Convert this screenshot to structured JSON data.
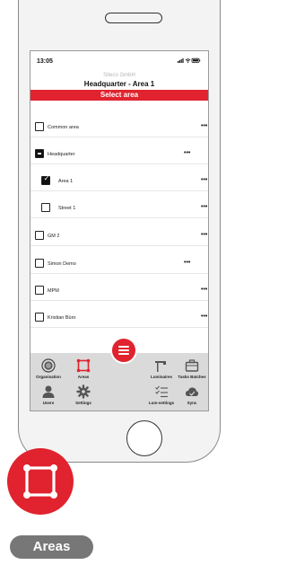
{
  "status_bar": {
    "time": "13:05",
    "icons": "signal-icon wifi-icon battery-icon"
  },
  "header": {
    "company": "Siteco GmbH",
    "area_title": "Headquarter - Area 1",
    "select_area": "Select area"
  },
  "rows": [
    {
      "label": "Common area",
      "checked": false,
      "indent": false,
      "dots": "•••",
      "chevron": ""
    },
    {
      "label": "Headquarter",
      "checked": "partial",
      "indent": false,
      "dots": "•••",
      "chevron": "˄"
    },
    {
      "label": "Area 1",
      "checked": true,
      "indent": true,
      "dots": "•••",
      "chevron": ""
    },
    {
      "label": "Street 1",
      "checked": false,
      "indent": true,
      "dots": "•••",
      "chevron": ""
    },
    {
      "label": "GM 2",
      "checked": false,
      "indent": false,
      "dots": "•••",
      "chevron": ""
    },
    {
      "label": "Simon Demo",
      "checked": false,
      "indent": false,
      "dots": "•••",
      "chevron": "˅"
    },
    {
      "label": "MPM",
      "checked": false,
      "indent": false,
      "dots": "•••",
      "chevron": ""
    },
    {
      "label": "Kristian Büro",
      "checked": false,
      "indent": false,
      "dots": "•••",
      "chevron": ""
    }
  ],
  "bottom_nav": {
    "organisation": "Organisation",
    "areas": "Areas",
    "luminaires": "Luminaires",
    "tasks_batches": "Tasks Batches",
    "users": "Users",
    "settings": "Settings",
    "lum_settings": "Lum-settings",
    "sync": "Sync"
  },
  "feature_label": "Areas",
  "colors": {
    "accent": "#e0232e",
    "pill": "#777777",
    "nav_bg": "#dadada"
  }
}
